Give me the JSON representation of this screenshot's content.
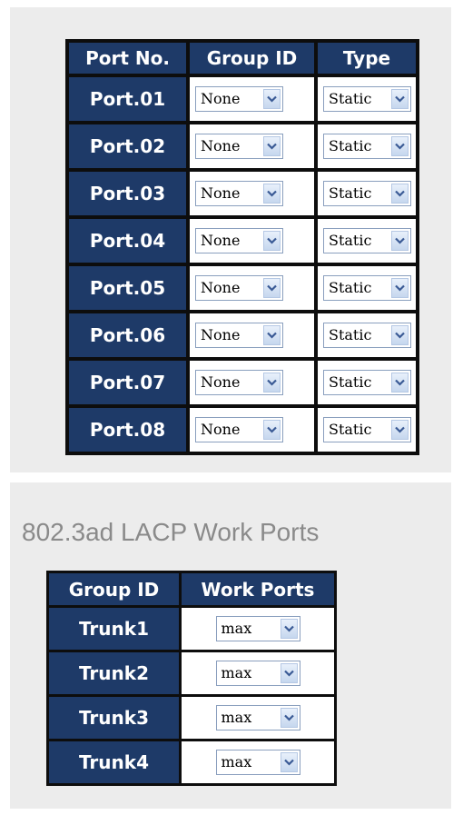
{
  "ports_table": {
    "headers": [
      "Port No.",
      "Group ID",
      "Type"
    ],
    "rows": [
      {
        "port": "Port.01",
        "group": "None",
        "type": "Static"
      },
      {
        "port": "Port.02",
        "group": "None",
        "type": "Static"
      },
      {
        "port": "Port.03",
        "group": "None",
        "type": "Static"
      },
      {
        "port": "Port.04",
        "group": "None",
        "type": "Static"
      },
      {
        "port": "Port.05",
        "group": "None",
        "type": "Static"
      },
      {
        "port": "Port.06",
        "group": "None",
        "type": "Static"
      },
      {
        "port": "Port.07",
        "group": "None",
        "type": "Static"
      },
      {
        "port": "Port.08",
        "group": "None",
        "type": "Static"
      }
    ]
  },
  "lacp": {
    "title": "802.3ad LACP Work Ports",
    "headers": [
      "Group ID",
      "Work Ports"
    ],
    "rows": [
      {
        "group": "Trunk1",
        "work": "max"
      },
      {
        "group": "Trunk2",
        "work": "max"
      },
      {
        "group": "Trunk3",
        "work": "max"
      },
      {
        "group": "Trunk4",
        "work": "max"
      }
    ]
  },
  "icons": {
    "dropdown": "chevron-down-icon"
  },
  "colors": {
    "header_bg": "#1e3a68",
    "panel_bg": "#ececec",
    "title_gray": "#8a8a8a"
  }
}
